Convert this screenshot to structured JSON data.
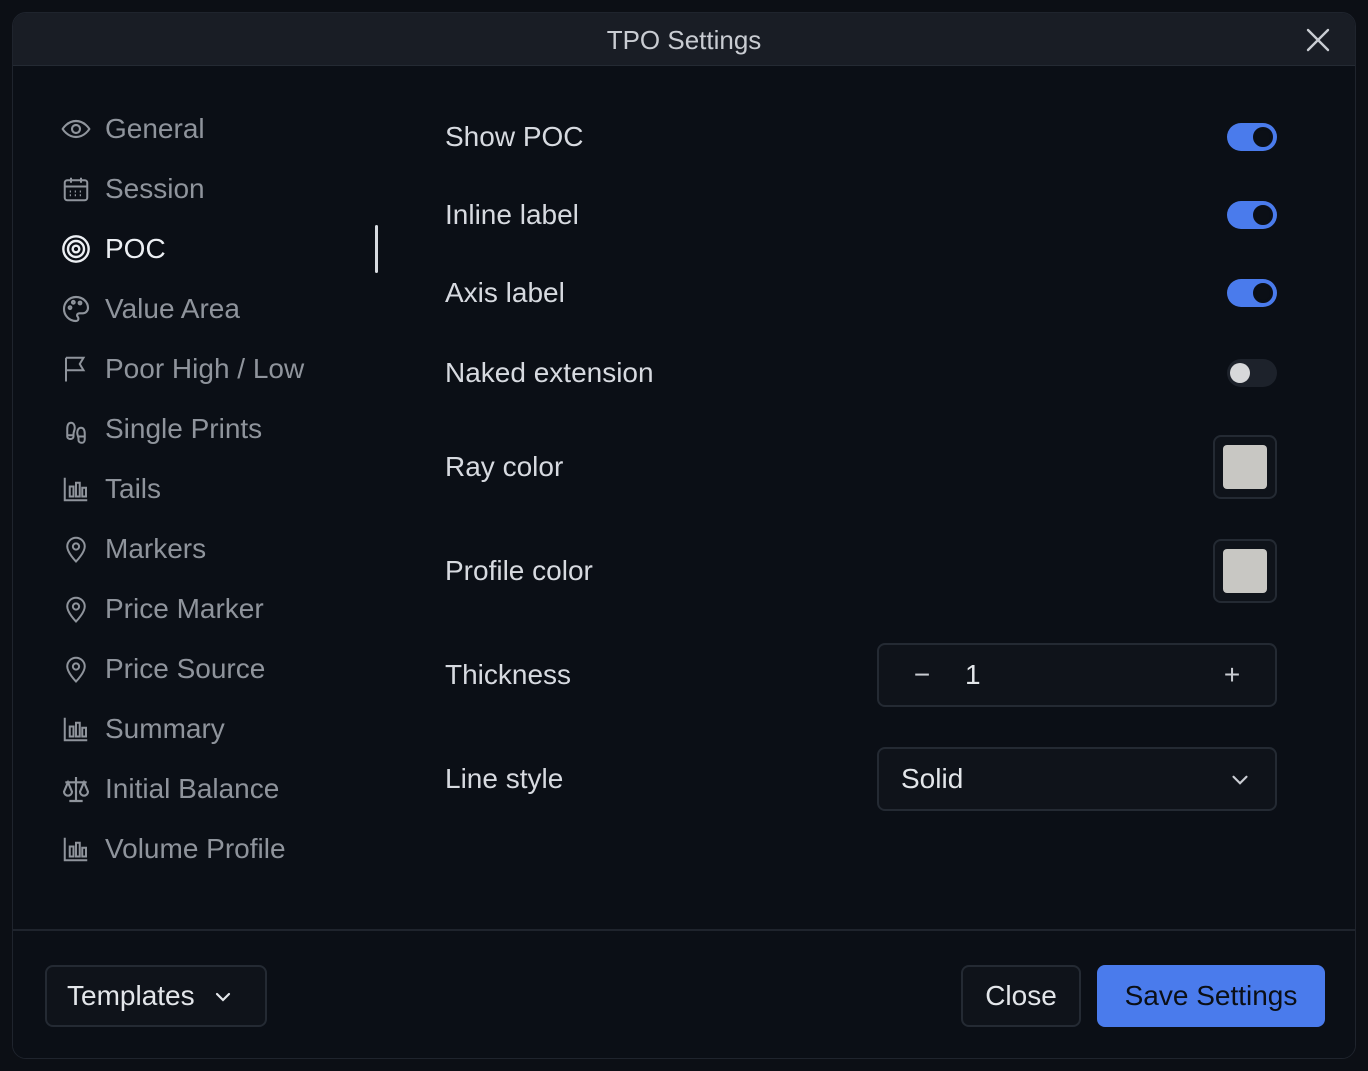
{
  "dialog": {
    "title": "TPO Settings"
  },
  "sidebar": {
    "items": [
      {
        "label": "General",
        "icon": "eye-icon"
      },
      {
        "label": "Session",
        "icon": "calendar-icon"
      },
      {
        "label": "POC",
        "icon": "target-icon",
        "active": true
      },
      {
        "label": "Value Area",
        "icon": "palette-icon"
      },
      {
        "label": "Poor High / Low",
        "icon": "flag-icon"
      },
      {
        "label": "Single Prints",
        "icon": "footprints-icon"
      },
      {
        "label": "Tails",
        "icon": "bar-chart-icon"
      },
      {
        "label": "Markers",
        "icon": "map-pin-icon"
      },
      {
        "label": "Price Marker",
        "icon": "map-pin-icon"
      },
      {
        "label": "Price Source",
        "icon": "map-pin-icon"
      },
      {
        "label": "Summary",
        "icon": "bar-chart-icon"
      },
      {
        "label": "Initial Balance",
        "icon": "scale-icon"
      },
      {
        "label": "Volume Profile",
        "icon": "bar-chart-icon"
      }
    ]
  },
  "settings": {
    "show_poc": {
      "label": "Show POC",
      "enabled": true
    },
    "inline_label": {
      "label": "Inline label",
      "enabled": true
    },
    "axis_label": {
      "label": "Axis label",
      "enabled": true
    },
    "naked_extension": {
      "label": "Naked extension",
      "enabled": false
    },
    "ray_color": {
      "label": "Ray color",
      "color": "#c8c7c3"
    },
    "profile_color": {
      "label": "Profile color",
      "color": "#c8c7c3"
    },
    "thickness": {
      "label": "Thickness",
      "value": "1",
      "minus": "−",
      "plus": "+"
    },
    "line_style": {
      "label": "Line style",
      "value": "Solid"
    }
  },
  "footer": {
    "templates_label": "Templates",
    "close_label": "Close",
    "save_label": "Save Settings"
  },
  "colors": {
    "accent": "#4a7bec",
    "background": "#0b0f16"
  }
}
